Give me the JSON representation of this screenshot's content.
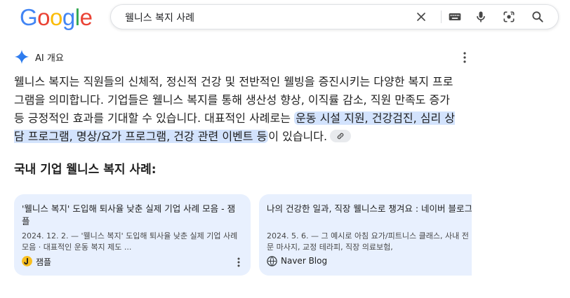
{
  "header": {
    "logo_letters": [
      "G",
      "o",
      "o",
      "g",
      "l",
      "e"
    ],
    "logo_colors": [
      "#4285F4",
      "#EA4335",
      "#FBBC05",
      "#4285F4",
      "#34A853",
      "#EA4335"
    ],
    "search_query": "웰니스 복지 사례",
    "icons": [
      "close-icon",
      "keyboard-icon",
      "mic-icon",
      "lens-icon",
      "search-icon"
    ]
  },
  "overview": {
    "title": "AI 개요",
    "answer_plain": "웰니스 복지는 직원들의 신체적, 정신적 건강 및 전반적인 웰빙을 증진시키는 다양한 복지 프로그램을 의미합니다. 기업들은 웰니스 복지를 통해 생산성 향상, 이직률 감소, 직원 만족도 증가 등 긍정적인 효과를 기대할 수 있습니다. 대표적인 사례로는 ",
    "answer_highlight": "운동 시설 지원, 건강검진, 심리 상담 프로그램, 명상/요가 프로그램, 건강 관련 이벤트 등",
    "answer_tail": "이 있습니다.",
    "subheading": "국내 기업 웰니스 복지 사례:",
    "highlight_color": "#d3e3fd"
  },
  "cards": [
    {
      "title": "'웰니스 복지' 도입해 퇴사율 낮춘 실제 기업 사례 모음 - 잼플",
      "snippet": "2024. 12. 2. — '웰니스 복지' 도입해 퇴사율 낮춘 실제 기업 사례 모음 · 대표적인 운동 복지 제도 ...",
      "source": "잼플"
    },
    {
      "title": "나의 건강한 일과, 직장 웰니스로 챙겨요 : 네이버 블로그",
      "snippet": "2024. 5. 6. — 그 예시로 아침 요가/피트니스 클래스, 사내 전문 마사지, 교정 테라피, 직장 의료보험,",
      "source": "Naver Blog"
    }
  ]
}
